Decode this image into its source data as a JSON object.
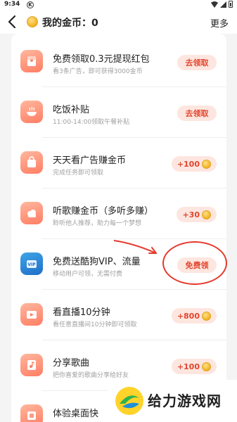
{
  "status_bar": {
    "time": "9:34",
    "notification_glyph": "K"
  },
  "header": {
    "title": "我的金币：0",
    "more_label": "更多"
  },
  "tasks": [
    {
      "title": "免费领取0.3元提现红包",
      "subtitle": "看3条广告，即可获得3000金币",
      "action": "去领取",
      "icon": "red-packet-icon"
    },
    {
      "title": "吃饭补贴",
      "subtitle": "11:00-14:00领取午餐补贴",
      "action": "去领取",
      "icon": "bowl-icon"
    },
    {
      "title": "天天看广告赚金币",
      "subtitle": "完成任务即可领取",
      "action": "+100",
      "icon": "shopping-bag-icon"
    },
    {
      "title": "听歌赚金币（多听多赚）",
      "subtitle": "聆听他人推荐，助力每一个梦想",
      "action": "+30",
      "icon": "cloud-icon"
    },
    {
      "title": "免费送酷狗VIP、流量",
      "subtitle": "移动用户可领，无需付费",
      "action": "免费领",
      "icon": "vip-gift-icon"
    },
    {
      "title": "看直播10分钟",
      "subtitle": "看任意直播间10分钟即可领取",
      "action": "+800",
      "icon": "play-icon"
    },
    {
      "title": "分享歌曲",
      "subtitle": "把你喜爱的歌曲分享给好友",
      "action": "+100",
      "icon": "music-share-icon"
    },
    {
      "title": "体验桌面快",
      "subtitle": "",
      "action": "",
      "icon": "desktop-icon"
    }
  ],
  "watermark": {
    "text": "给力游戏网"
  },
  "colors": {
    "accent": "#e2462f",
    "button_bg": "#fde6df",
    "coin": "#f2b21c",
    "annotation": "#e53a2d"
  }
}
